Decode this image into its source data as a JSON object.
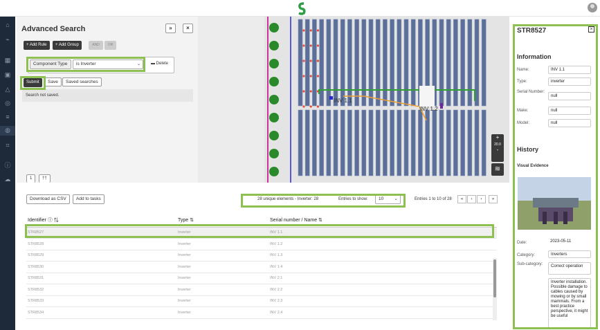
{
  "app": {
    "logo": "s-logo-icon",
    "user": "user-avatar-icon"
  },
  "sidebar": {
    "icons": [
      "home-icon",
      "chart-icon",
      "grid-icon",
      "grid-icon",
      "calendar-icon",
      "warning-icon",
      "target-icon",
      "list-icon",
      "globe-icon",
      "crop-icon",
      "info-icon",
      "cloud-icon"
    ]
  },
  "search": {
    "title": "Advanced Search",
    "collapse": "»",
    "close": "×",
    "add_rule": "+ Add Rule",
    "add_group": "+ Add Group",
    "and": "AND",
    "or": "OR",
    "field": "Component Type",
    "operator": "is Inverter",
    "delete": "Delete",
    "submit": "Submit",
    "save": "Save",
    "saved_searches": "Saved searches",
    "status": "Search not saved."
  },
  "map": {
    "zoom_in": "+",
    "zoom_level": "20.0",
    "zoom_out": "-",
    "label1": "INV 1.1",
    "label2": "INV 1.2"
  },
  "tabs": [
    "1",
    "††"
  ],
  "table": {
    "download": "Download as CSV",
    "add_tasks": "Add to tasks",
    "summary": "28 unique elements - Inverter: 28",
    "entries_label": "Entries to show:",
    "entries_value": "10",
    "range": "Entries 1 to 10 of 28",
    "pager": [
      "«",
      "‹",
      "›",
      "»"
    ],
    "headers": [
      "Identifier",
      "Type",
      "Serial number / Name"
    ],
    "rows": [
      [
        "STR8527",
        "Inverter",
        "INV 1.1"
      ],
      [
        "STR8528",
        "Inverter",
        "INV 1.2"
      ],
      [
        "STR8529",
        "Inverter",
        "INV 1.3"
      ],
      [
        "STR8530",
        "Inverter",
        "INV 1.4"
      ],
      [
        "STR8531",
        "Inverter",
        "INV 2.1"
      ],
      [
        "STR8532",
        "Inverter",
        "INV 2.2"
      ],
      [
        "STR8533",
        "Inverter",
        "INV 2.3"
      ],
      [
        "STR8534",
        "Inverter",
        "INV 2.4"
      ]
    ]
  },
  "detail": {
    "title": "STR8527",
    "close": "×",
    "info_heading": "Information",
    "name_label": "Name:",
    "name": "INV 1.1",
    "type_label": "Type:",
    "type": "inverter",
    "serial_label": "Serial Number:",
    "serial": "null",
    "make_label": "Make:",
    "make": "null",
    "model_label": "Model:",
    "model": "null",
    "history_heading": "History",
    "visual_evidence": "Visual Evidence",
    "date_label": "Date:",
    "date": "2023-05-11",
    "category_label": "Category:",
    "category": "Inverters",
    "subcategory_label": "Sub-category:",
    "subcategory": "Correct operation",
    "description": "Inverter installation. Possible damage to cables caused by mowing or by small mammals. From a best practice perspective, it might be useful"
  },
  "colors": {
    "accent": "#8cc152",
    "sidebar": "#1e2a3a",
    "row_fill": "#5b6f99",
    "string_red": "#e74c3c"
  }
}
